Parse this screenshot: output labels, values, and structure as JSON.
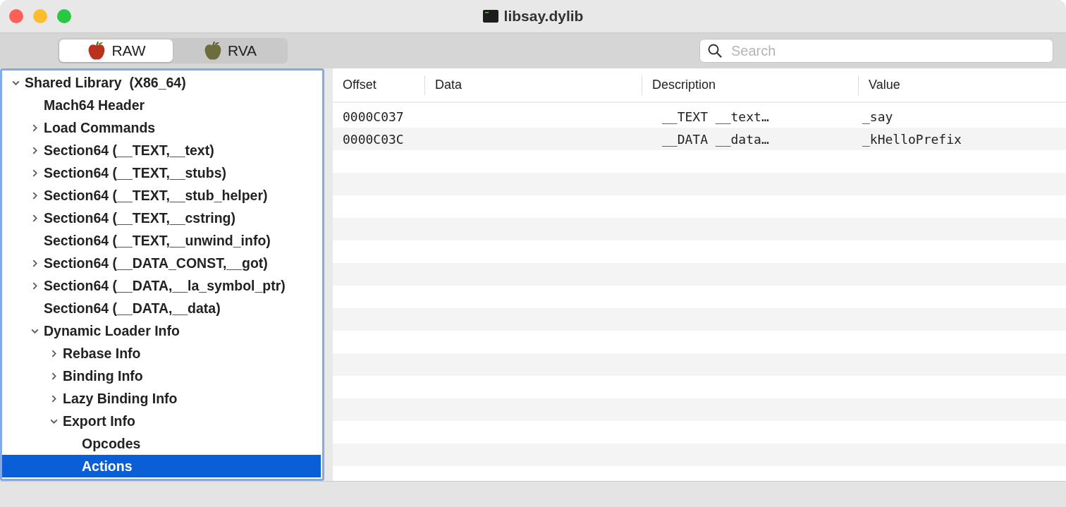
{
  "window": {
    "title": "libsay.dylib"
  },
  "toolbar": {
    "modes": [
      {
        "label": "RAW",
        "selected": true
      },
      {
        "label": "RVA",
        "selected": false
      }
    ],
    "search": {
      "placeholder": "Search"
    }
  },
  "sidebar": {
    "tree": [
      {
        "label": "Shared Library  (X86_64)",
        "expanded": true,
        "selected": false,
        "children": [
          {
            "label": "Mach64 Header",
            "selected": false
          },
          {
            "label": "Load Commands",
            "expanded": false,
            "selected": false
          },
          {
            "label": "Section64 (__TEXT,__text)",
            "expanded": false,
            "selected": false
          },
          {
            "label": "Section64 (__TEXT,__stubs)",
            "expanded": false,
            "selected": false
          },
          {
            "label": "Section64 (__TEXT,__stub_helper)",
            "expanded": false,
            "selected": false
          },
          {
            "label": "Section64 (__TEXT,__cstring)",
            "expanded": false,
            "selected": false
          },
          {
            "label": "Section64 (__TEXT,__unwind_info)",
            "selected": false
          },
          {
            "label": "Section64 (__DATA_CONST,__got)",
            "expanded": false,
            "selected": false
          },
          {
            "label": "Section64 (__DATA,__la_symbol_ptr)",
            "expanded": false,
            "selected": false
          },
          {
            "label": "Section64 (__DATA,__data)",
            "selected": false
          },
          {
            "label": "Dynamic Loader Info",
            "expanded": true,
            "selected": false,
            "children": [
              {
                "label": "Rebase Info",
                "expanded": false,
                "selected": false
              },
              {
                "label": "Binding Info",
                "expanded": false,
                "selected": false
              },
              {
                "label": "Lazy Binding Info",
                "expanded": false,
                "selected": false
              },
              {
                "label": "Export Info",
                "expanded": true,
                "selected": false,
                "children": [
                  {
                    "label": "Opcodes",
                    "selected": false
                  },
                  {
                    "label": "Actions",
                    "selected": true
                  }
                ]
              }
            ]
          }
        ]
      }
    ]
  },
  "table": {
    "columns": [
      "Offset",
      "Data",
      "Description",
      "Value"
    ],
    "rows": [
      {
        "offset": "0000C037",
        "description": "__TEXT __text…",
        "value": "_say"
      },
      {
        "offset": "0000C03C",
        "description": "__DATA __data…",
        "value": "_kHelloPrefix"
      }
    ]
  }
}
